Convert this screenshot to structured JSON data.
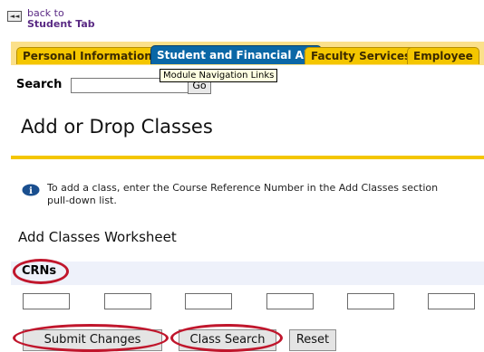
{
  "back_link": {
    "icon_text": "◄◄",
    "line1": "back to",
    "line2": "Student Tab"
  },
  "tabs": [
    {
      "label": "Personal Information"
    },
    {
      "label": "Student and Financial Aid"
    },
    {
      "label": "Faculty Services"
    },
    {
      "label": "Employee"
    }
  ],
  "tooltip": "Module Navigation Links",
  "search": {
    "label": "Search",
    "go_label": "Go",
    "value": ""
  },
  "page_title": "Add or Drop Classes",
  "info": {
    "icon": "info-icon",
    "line1": "To add a class, enter the Course Reference Number in the Add Classes section",
    "line2": "pull-down list."
  },
  "worksheet_title": "Add Classes Worksheet",
  "crn_header": "CRNs",
  "crn_inputs": [
    "",
    "",
    "",
    "",
    "",
    ""
  ],
  "buttons": {
    "submit": "Submit Changes",
    "class_search": "Class Search",
    "reset": "Reset"
  },
  "colors": {
    "tab_active": "#0a67a6",
    "tab": "#f4c600",
    "highlight_circle": "#c0162c"
  }
}
